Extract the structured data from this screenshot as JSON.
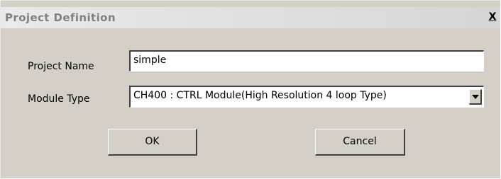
{
  "window": {
    "title": "Project Definition",
    "close_glyph": "X"
  },
  "form": {
    "project_name_label": "Project Name",
    "project_name_value": "simple",
    "module_type_label": "Module Type",
    "module_type_value": "CH400 : CTRL Module(High Resolution 4 loop Type)"
  },
  "buttons": {
    "ok_label": "OK",
    "cancel_label": "Cancel"
  },
  "colors": {
    "dialog_face": "#d4d0c8",
    "title_text": "#808080",
    "titlebar_inactive": "#e0e0e0"
  },
  "icons": {
    "close": "close-icon",
    "dropdown": "chevron-down-icon"
  }
}
